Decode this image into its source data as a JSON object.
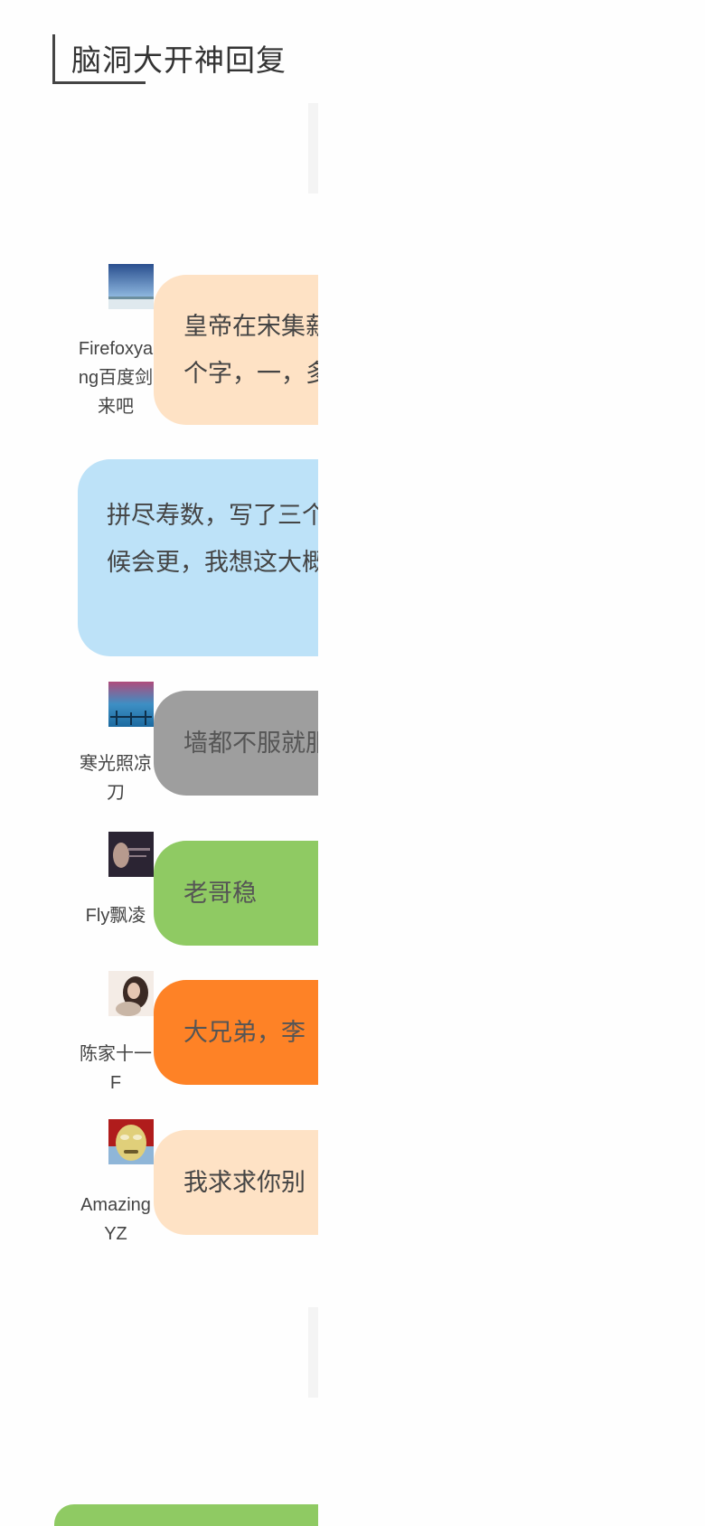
{
  "section": {
    "title": "脑洞大开神回复"
  },
  "replies": [
    {
      "author": "Firefoxyang百度剑来吧",
      "text": "皇帝在宋集薪的名字上，写了三个字，一，多，寿，三，小人",
      "avatar_icon": "sky-landscape-avatar",
      "color": "#fee2c5"
    },
    {
      "author": "",
      "text": "拼尽寿数，写了三个字，你们说什么时候会更，我想这大概是意思吧",
      "color": "#bde2f8"
    },
    {
      "author": "寒光照凉刀",
      "text": "墙都不服就服你",
      "avatar_icon": "bridge-avatar",
      "color": "#9e9e9e"
    },
    {
      "author": "Fly飘凌",
      "text": "老哥稳",
      "avatar_icon": "portrait-avatar",
      "color": "#8fca63"
    },
    {
      "author": "陈家十一F",
      "text": "大兄弟，李",
      "avatar_icon": "woman-avatar",
      "color": "#fe8226"
    },
    {
      "author": "AmazingYZ",
      "text": "我求求你别",
      "avatar_icon": "mask-avatar",
      "color": "#fee2c5"
    }
  ]
}
